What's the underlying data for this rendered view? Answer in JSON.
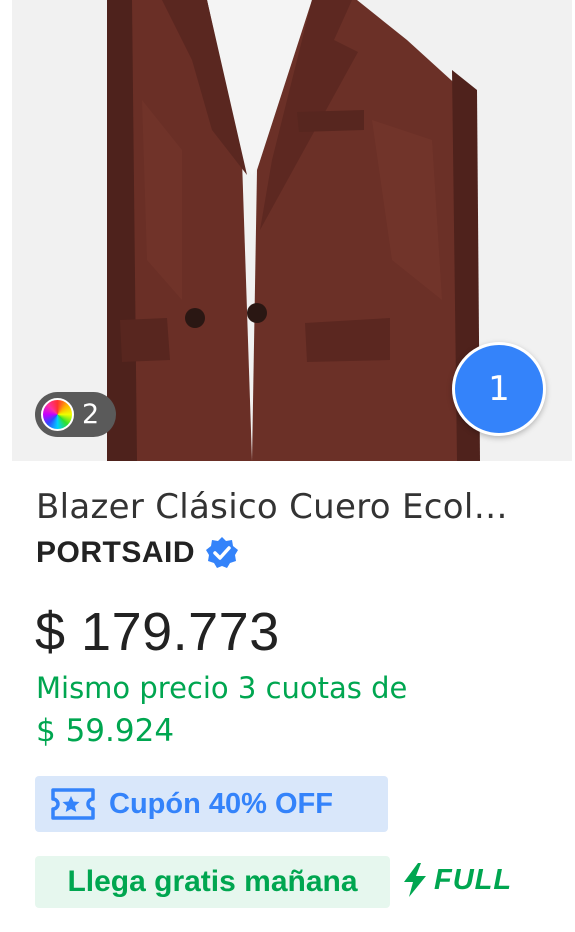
{
  "product": {
    "image_alt": "product-photo-brown-leather-blazer",
    "color_count": "2",
    "cart_count": "1",
    "title": "Blazer Clásico Cuero Ecol…",
    "brand": "PORTSAID",
    "price": "$ 179.773",
    "installments_line1": "Mismo precio 3 cuotas de",
    "installments_line2": "$ 59.924",
    "coupon_label": "Cupón 40% OFF",
    "shipping_label": "Llega gratis mañana",
    "full_label": "FULL"
  },
  "icons": {
    "color": "color-wheel-icon",
    "verified": "verified-badge-icon",
    "coupon": "coupon-ticket-icon",
    "full": "lightning-bolt-icon"
  },
  "colors": {
    "accent_blue": "#3483fa",
    "green": "#00a650",
    "coupon_bg": "#d9e7fa",
    "shipping_bg": "#e6f7ee"
  }
}
